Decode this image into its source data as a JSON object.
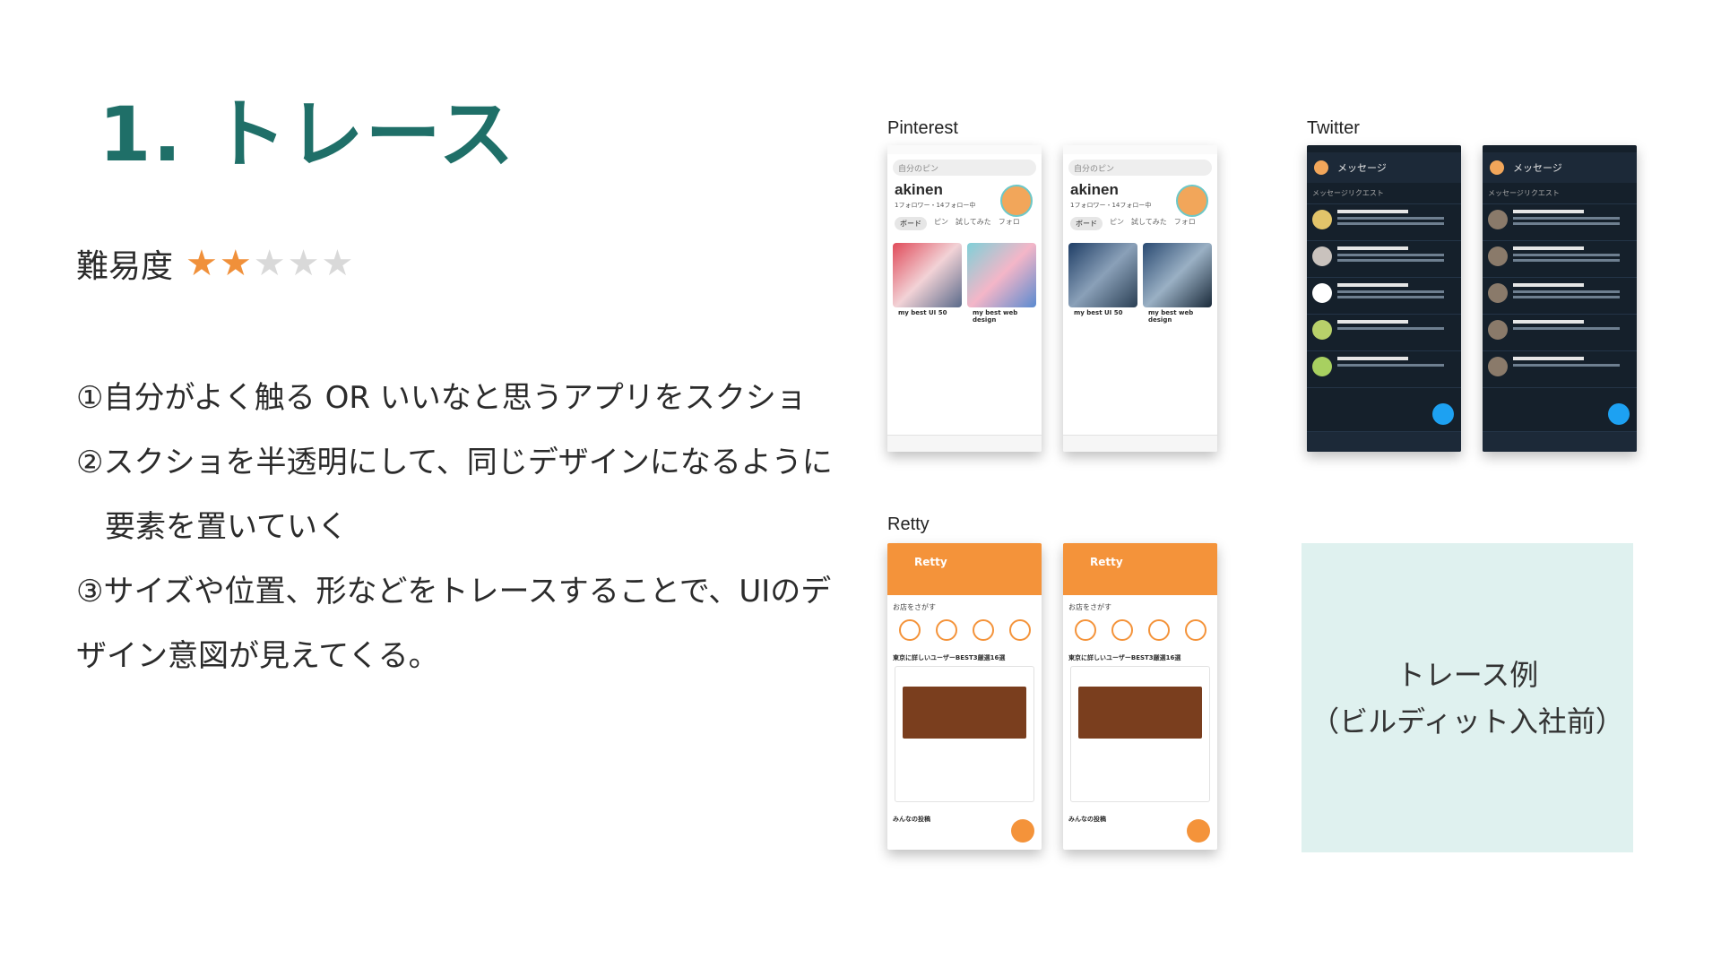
{
  "title": "1. トレース",
  "difficulty": {
    "label": "難易度",
    "rating": 2,
    "max": 5
  },
  "steps": [
    "①自分がよく触る OR いいなと思うアプリをスクショ",
    "②スクショを半透明にして、同じデザインになるように",
    "要素を置いていく",
    "③サイズや位置、形などをトレースすることで、UIのデ",
    "ザイン意図が見えてくる。"
  ],
  "screenshots": {
    "pinterest": {
      "label": "Pinterest",
      "search": "自分のピン",
      "name": "akinen",
      "follow": "1フォロワー・14フォロー中",
      "tabs": [
        "ボード",
        "ピン",
        "試してみた",
        "フォロ"
      ],
      "board1": "my best UI 50",
      "board2": "my best web design"
    },
    "twitter": {
      "label": "Twitter",
      "header": "メッセージ",
      "requests": "メッセージリクエスト"
    },
    "retty": {
      "label": "Retty",
      "brand": "Retty",
      "search": "お店をさがす",
      "section": "東京に詳しいユーザーBEST3厳選16選",
      "footer": "みんなの投稿"
    }
  },
  "example": {
    "line1": "トレース例",
    "line2": "（ビルディット入社前）"
  },
  "colors": {
    "title": "#1f6f68",
    "star_on": "#f0903a",
    "star_off": "#d9d9d9",
    "example_bg": "#dff1ef",
    "retty": "#f4933a",
    "twitter_bg": "#15202b"
  }
}
